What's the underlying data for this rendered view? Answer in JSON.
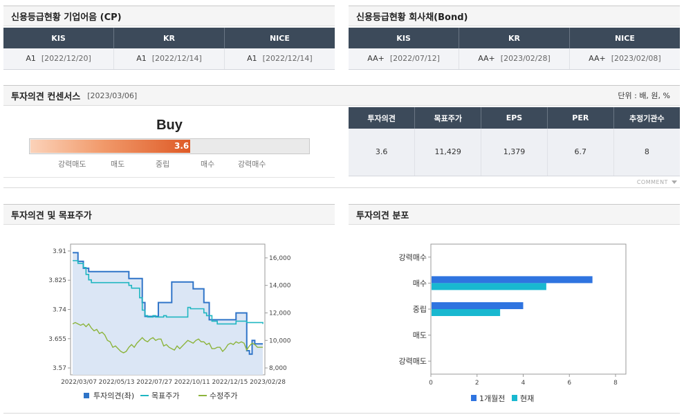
{
  "cp_rating": {
    "title": "신용등급현황 기업어음 (CP)",
    "columns": [
      "KIS",
      "KR",
      "NICE"
    ],
    "grades": [
      "A1",
      "A1",
      "A1"
    ],
    "dates": [
      "[2022/12/20]",
      "[2022/12/14]",
      "[2022/12/14]"
    ]
  },
  "bond_rating": {
    "title": "신용등급현황 회사채(Bond)",
    "columns": [
      "KIS",
      "KR",
      "NICE"
    ],
    "grades": [
      "AA+",
      "AA+",
      "AA+"
    ],
    "dates": [
      "[2022/07/12]",
      "[2023/02/28]",
      "[2023/02/08]"
    ]
  },
  "consensus": {
    "title": "투자의견 컨센서스",
    "date": "[2023/03/06]",
    "unit": "단위 : 배, 원, %",
    "opinion_text": "Buy",
    "score": 3.6,
    "score_label": "3.6",
    "score_max": 5,
    "scale_labels": [
      "강력매도",
      "매도",
      "중립",
      "매수",
      "강력매수"
    ],
    "table_headers": [
      "투자의견",
      "목표주가",
      "EPS",
      "PER",
      "추정기관수"
    ],
    "table_values": [
      "3.6",
      "11,429",
      "1,379",
      "6.7",
      "8"
    ],
    "comment_label": "COMMENT"
  },
  "chart_data": [
    {
      "type": "line",
      "title": "투자의견 및 목표주가",
      "x_ticks": [
        "2022/03/07",
        "2022/05/13",
        "2022/07/27",
        "2022/10/11",
        "2022/12/15",
        "2023/02/28"
      ],
      "y_left_ticks": [
        "3.91",
        "3.825",
        "3.74",
        "3.655",
        "3.57"
      ],
      "y_left_range": [
        3.55,
        3.93
      ],
      "y_right_ticks": [
        "16,000",
        "14,000",
        "12,000",
        "10,000",
        "8,000"
      ],
      "y_right_range": [
        7500,
        17000
      ],
      "legend": [
        "투자의견(좌)",
        "목표주가",
        "수정주가"
      ],
      "colors": {
        "opinion": "#2f74c8",
        "target": "#1fb6c1",
        "price": "#8cb43c",
        "area": "#dbe6f5"
      },
      "series": [
        {
          "name": "투자의견(좌)",
          "axis": "left",
          "values": [
            3.905,
            3.905,
            3.88,
            3.88,
            3.86,
            3.86,
            3.85,
            3.85,
            3.85,
            3.85,
            3.85,
            3.85,
            3.85,
            3.85,
            3.85,
            3.85,
            3.85,
            3.85,
            3.85,
            3.85,
            3.85,
            3.83,
            3.83,
            3.83,
            3.83,
            3.83,
            3.76,
            3.72,
            3.72,
            3.72,
            3.72,
            3.72,
            3.76,
            3.76,
            3.76,
            3.76,
            3.76,
            3.82,
            3.82,
            3.82,
            3.82,
            3.82,
            3.82,
            3.82,
            3.82,
            3.8,
            3.8,
            3.8,
            3.8,
            3.76,
            3.76,
            3.71,
            3.71,
            3.71,
            3.71,
            3.71,
            3.71,
            3.71,
            3.71,
            3.71,
            3.71,
            3.73,
            3.73,
            3.73,
            3.73,
            3.62,
            3.61,
            3.65,
            3.64,
            3.64,
            3.64,
            3.64
          ]
        },
        {
          "name": "목표주가",
          "axis": "right",
          "values": [
            15800,
            15800,
            15600,
            15600,
            15300,
            14800,
            14400,
            14200,
            14200,
            14200,
            14200,
            14200,
            14200,
            14200,
            14200,
            14200,
            14200,
            14200,
            14200,
            14200,
            14200,
            14000,
            13800,
            13800,
            13800,
            13100,
            12200,
            11800,
            11700,
            11700,
            11800,
            11700,
            11700,
            11700,
            11800,
            11700,
            11700,
            11700,
            11700,
            11700,
            11700,
            11700,
            11700,
            12400,
            12300,
            12300,
            12300,
            12300,
            12300,
            12000,
            11800,
            11800,
            11400,
            11400,
            11200,
            11200,
            11200,
            11200,
            11200,
            11200,
            11200,
            11400,
            11400,
            11400,
            11400,
            11300,
            11300,
            11300,
            11300,
            11300,
            11300,
            11200
          ]
        },
        {
          "name": "수정주가",
          "axis": "right",
          "values": [
            11200,
            11300,
            11200,
            11100,
            11200,
            11000,
            11200,
            10900,
            10700,
            10800,
            10500,
            10600,
            10400,
            10000,
            9900,
            9500,
            9600,
            9400,
            9200,
            9100,
            9200,
            9500,
            9700,
            9500,
            9800,
            10000,
            10200,
            10000,
            9900,
            10100,
            10200,
            10000,
            10100,
            10100,
            9600,
            9700,
            9500,
            9400,
            9300,
            9600,
            9400,
            9600,
            9800,
            10000,
            9900,
            9800,
            10000,
            10100,
            9900,
            9900,
            9700,
            9800,
            9400,
            9400,
            9500,
            9500,
            9200,
            9400,
            9700,
            9800,
            9700,
            9900,
            9800,
            9900,
            9800,
            9300,
            9600,
            9800,
            9700,
            9500,
            9500,
            9500
          ]
        }
      ]
    },
    {
      "type": "bar",
      "title": "투자의견 분포",
      "categories": [
        "강력매수",
        "매수",
        "중립",
        "매도",
        "강력매도"
      ],
      "x_ticks": [
        "0",
        "2",
        "4",
        "6",
        "8"
      ],
      "xlim": [
        0,
        8
      ],
      "legend": [
        "1개월전",
        "현재"
      ],
      "colors": {
        "prev": "#2f74e0",
        "curr": "#19b8d0"
      },
      "series": [
        {
          "name": "1개월전",
          "values": [
            0,
            7,
            4,
            0,
            0
          ]
        },
        {
          "name": "현재",
          "values": [
            0,
            5,
            3,
            0,
            0
          ]
        }
      ]
    }
  ]
}
